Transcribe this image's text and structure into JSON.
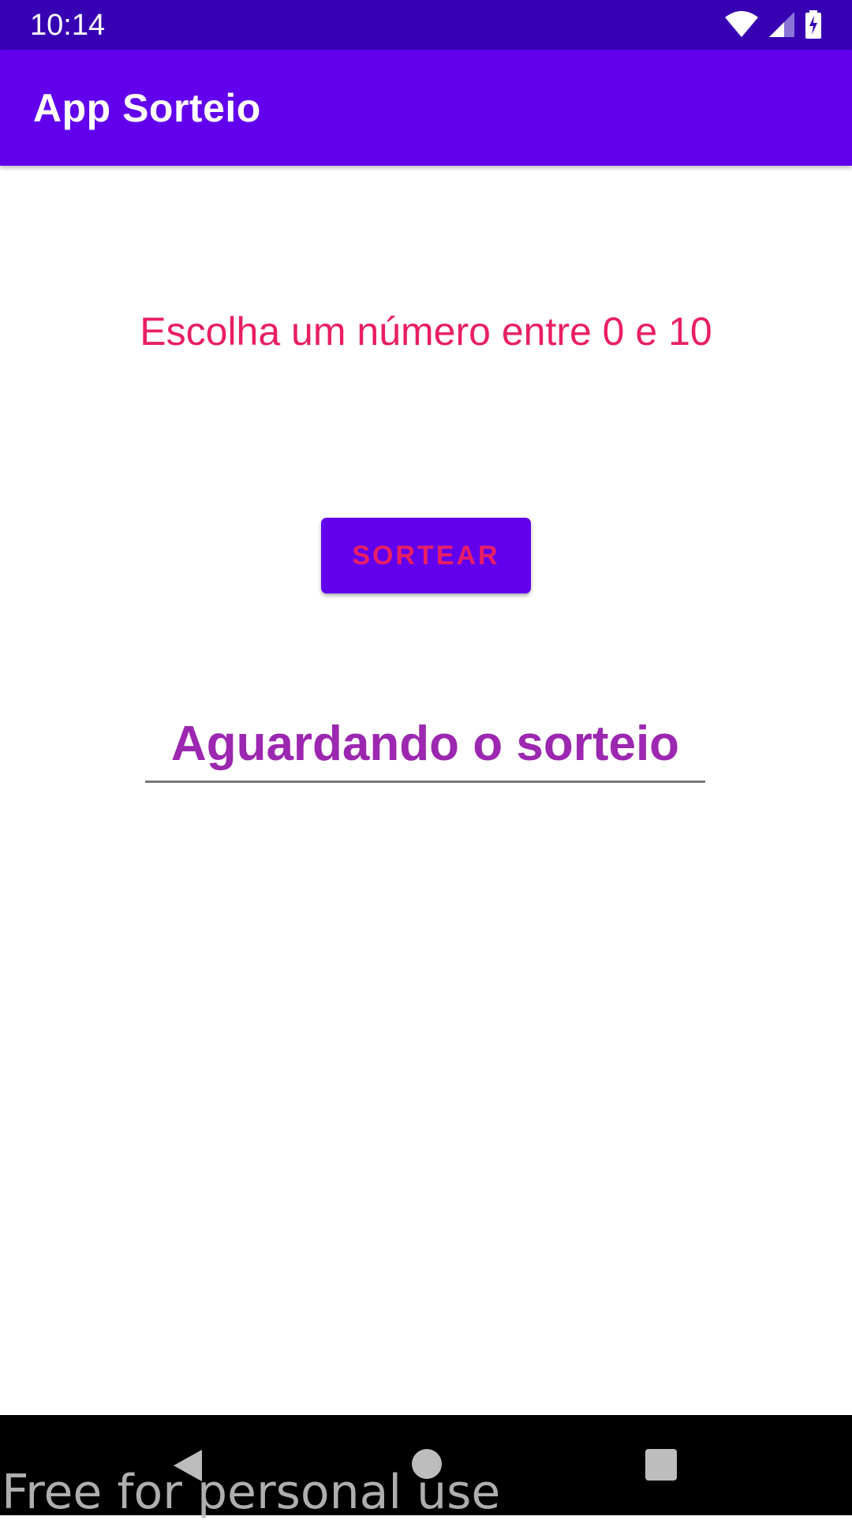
{
  "status_bar": {
    "time": "10:14",
    "icons": [
      "wifi-icon",
      "signal-icon",
      "battery-charging-icon"
    ]
  },
  "app_bar": {
    "title": "App Sorteio",
    "color": "#6200ee"
  },
  "main": {
    "instruction": "Escolha um número entre 0 e 10",
    "instruction_color": "#e91e63",
    "draw_button_label": "SORTEAR",
    "result_text": "Aguardando o sorteio",
    "result_color": "#9c27b0"
  },
  "nav_bar": {
    "buttons": [
      "back-icon",
      "home-icon",
      "recents-icon"
    ]
  },
  "watermark": "Free for personal use"
}
